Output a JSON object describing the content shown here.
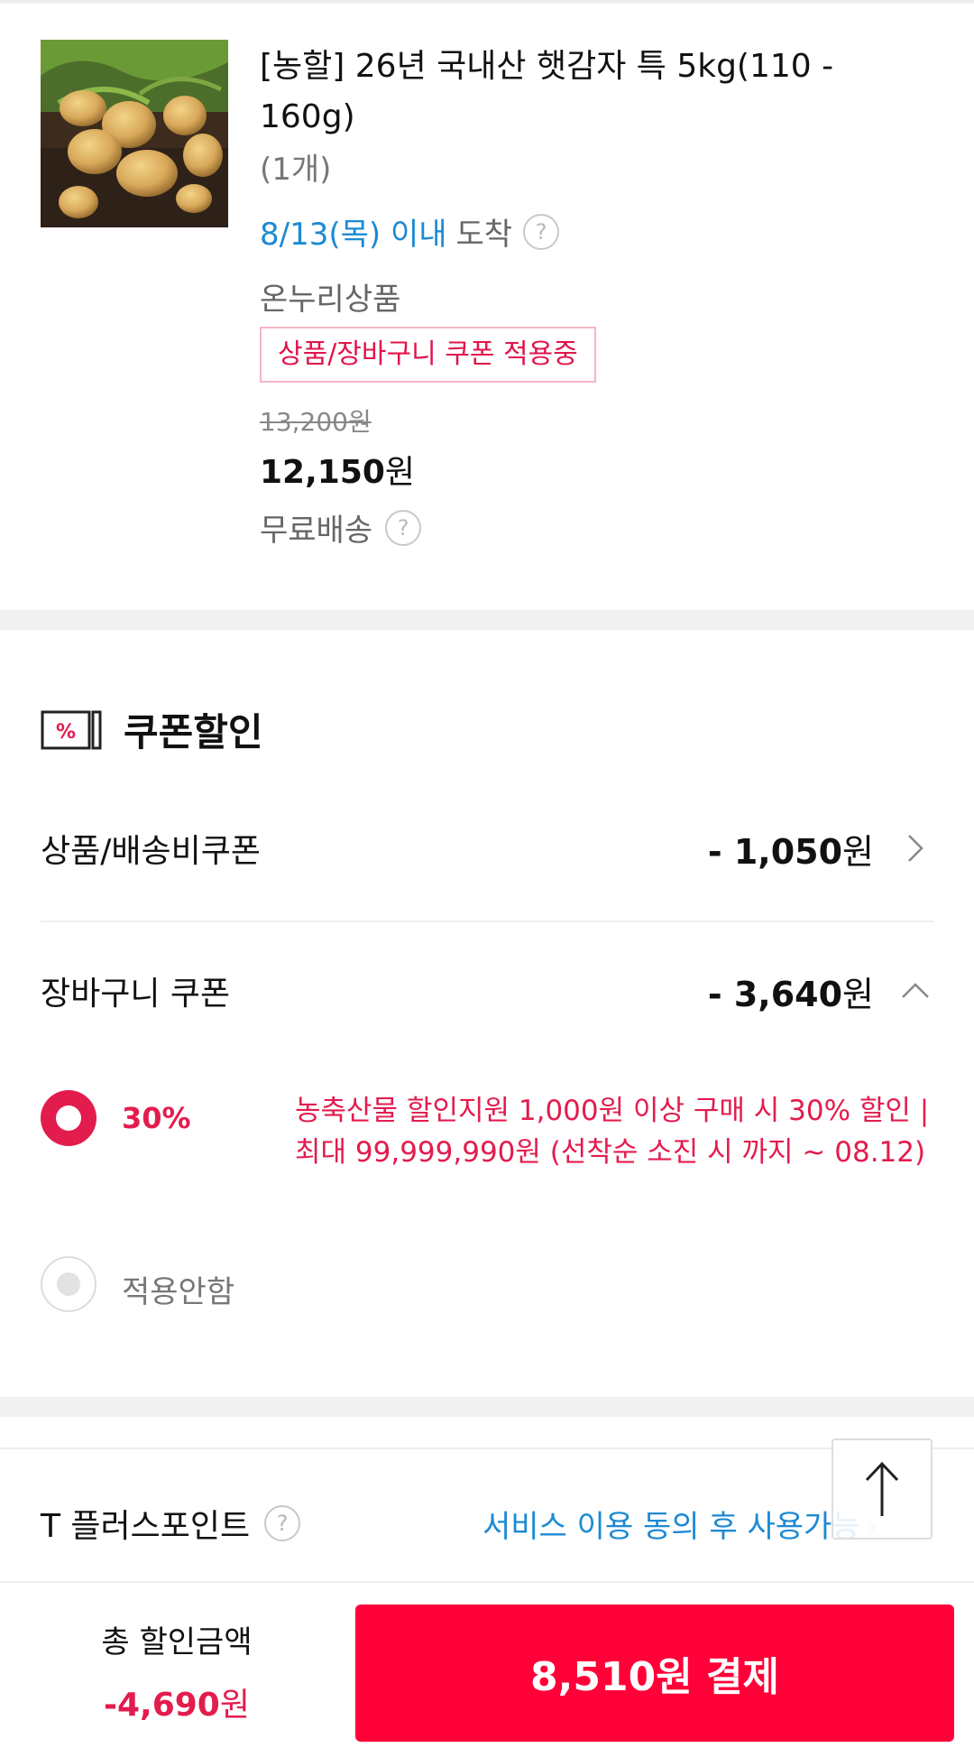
{
  "product": {
    "title": "[농할] 26년 국내산 햇감자 특 5kg(110 - 160g)",
    "quantity": "(1개)",
    "arrival_date": "8/13(목) 이내",
    "arrival_suffix": "도착",
    "onnuri": "온누리상품",
    "coupon_tag": "상품/장바구니 쿠폰 적용중",
    "original_price": "13,200원",
    "price": "12,150",
    "price_unit": "원",
    "shipping": "무료배송",
    "help_glyph": "?"
  },
  "coupon": {
    "title": "쿠폰할인",
    "icon_glyph": "%",
    "rows": [
      {
        "label": "상품/배송비쿠폰",
        "amount": "- 1,050",
        "unit": "원"
      },
      {
        "label": "장바구니 쿠폰",
        "amount": "- 3,640",
        "unit": "원"
      }
    ],
    "options": [
      {
        "percent": "30%",
        "description": "농축산물 할인지원 1,000원 이상 구매 시 30% 할인 | 최대 99,999,990원 (선착순 소진 시 까지 ~ 08.12)",
        "selected": true
      },
      {
        "label": "적용안함",
        "selected": false
      }
    ]
  },
  "tplus": {
    "label": "T 플러스포인트",
    "link": "서비스 이용 동의 후 사용가능",
    "arrow": "›"
  },
  "bottom": {
    "total_label": "총 할인금액",
    "total_amount": "-4,690",
    "total_unit": "원",
    "pay_label": "8,510원 결제"
  },
  "colors": {
    "accent": "#ff0038",
    "discount_red": "#e31c4e",
    "link_blue": "#1c8ad3"
  }
}
